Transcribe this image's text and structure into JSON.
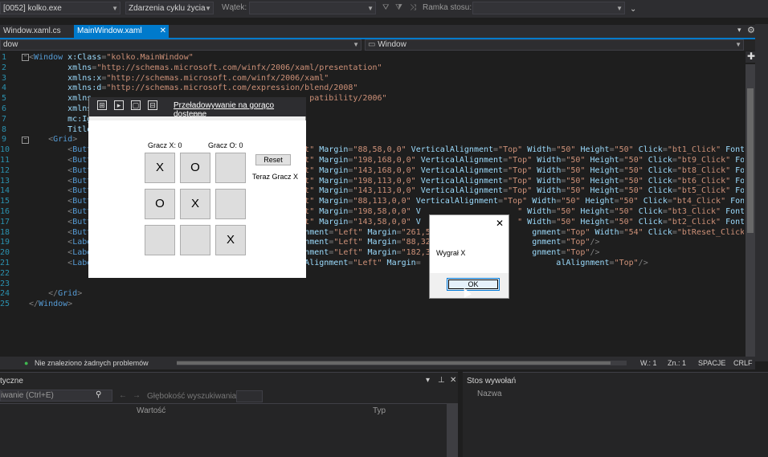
{
  "toolbar": {
    "process_value": "[0052] kolko.exe",
    "lifecycle_value": "Zdarzenia cyklu życia",
    "thread_label": "Wątek:",
    "thread_value": "",
    "stackframe_label": "Ramka stosu:",
    "stackframe_value": ""
  },
  "tabs": [
    {
      "label": "Window.xaml.cs"
    },
    {
      "label": "MainWindow.xaml",
      "close": "✕"
    }
  ],
  "nav": {
    "left": "dow",
    "right": "Window"
  },
  "editor": {
    "line_numbers": [
      "1",
      "2",
      "3",
      "4",
      "5",
      "6",
      "7",
      "8",
      "9",
      "10",
      "11",
      "12",
      "13",
      "14",
      "15",
      "16",
      "17",
      "18",
      "19",
      "20",
      "21",
      "22",
      "23",
      "24",
      "25"
    ],
    "lines": [
      [
        {
          "c": "p",
          "t": "<"
        },
        {
          "c": "t",
          "t": "Window"
        },
        {
          "c": "a",
          "t": " x:Class"
        },
        {
          "c": "p",
          "t": "="
        },
        {
          "c": "s",
          "t": "\"kolko.MainWindow\""
        }
      ],
      [
        {
          "c": "a",
          "t": "        xmlns"
        },
        {
          "c": "p",
          "t": "="
        },
        {
          "c": "s",
          "t": "\"http://schemas.microsoft.com/winfx/2006/xaml/presentation\""
        }
      ],
      [
        {
          "c": "a",
          "t": "        xmlns:x"
        },
        {
          "c": "p",
          "t": "="
        },
        {
          "c": "s",
          "t": "\"http://schemas.microsoft.com/winfx/2006/xaml\""
        }
      ],
      [
        {
          "c": "a",
          "t": "        xmlns:d"
        },
        {
          "c": "p",
          "t": "="
        },
        {
          "c": "s",
          "t": "\"http://schemas.microsoft.com/expression/blend/2008\""
        }
      ],
      [
        {
          "c": "a",
          "t": "        xmlns"
        },
        {
          "c": "s",
          "t": "                                             patibility/2006\""
        }
      ],
      [
        {
          "c": "a",
          "t": "        xmlns"
        }
      ],
      [
        {
          "c": "a",
          "t": "        mc:Ig"
        }
      ],
      [
        {
          "c": "a",
          "t": "        Title"
        },
        {
          "c": "s",
          "t": "                                         4\""
        },
        {
          "c": "p",
          "t": ">"
        }
      ],
      [
        {
          "c": "p",
          "t": "    <"
        },
        {
          "c": "t",
          "t": "Grid"
        },
        {
          "c": "p",
          "t": ">"
        }
      ],
      [
        {
          "c": "p",
          "t": "        <"
        },
        {
          "c": "t",
          "t": "Butt"
        },
        {
          "c": "s",
          "t": "                                          eft\""
        },
        {
          "c": "a",
          "t": " Margin"
        },
        {
          "c": "p",
          "t": "="
        },
        {
          "c": "s",
          "t": "\"88,58,0,0\""
        },
        {
          "c": "a",
          "t": " VerticalAlignment"
        },
        {
          "c": "p",
          "t": "="
        },
        {
          "c": "s",
          "t": "\"Top\""
        },
        {
          "c": "a",
          "t": " Width"
        },
        {
          "c": "p",
          "t": "="
        },
        {
          "c": "s",
          "t": "\"50\""
        },
        {
          "c": "a",
          "t": " Height"
        },
        {
          "c": "p",
          "t": "="
        },
        {
          "c": "s",
          "t": "\"50\""
        },
        {
          "c": "a",
          "t": " Click"
        },
        {
          "c": "p",
          "t": "="
        },
        {
          "c": "s",
          "t": "\"bt1_Click\""
        },
        {
          "c": "a",
          "t": " FontSize"
        }
      ],
      [
        {
          "c": "p",
          "t": "        <"
        },
        {
          "c": "t",
          "t": "Butt"
        },
        {
          "c": "s",
          "t": "                                          eft\""
        },
        {
          "c": "a",
          "t": " Margin"
        },
        {
          "c": "p",
          "t": "="
        },
        {
          "c": "s",
          "t": "\"198,168,0,0\""
        },
        {
          "c": "a",
          "t": " VerticalAlignment"
        },
        {
          "c": "p",
          "t": "="
        },
        {
          "c": "s",
          "t": "\"Top\""
        },
        {
          "c": "a",
          "t": " Width"
        },
        {
          "c": "p",
          "t": "="
        },
        {
          "c": "s",
          "t": "\"50\""
        },
        {
          "c": "a",
          "t": " Height"
        },
        {
          "c": "p",
          "t": "="
        },
        {
          "c": "s",
          "t": "\"50\""
        },
        {
          "c": "a",
          "t": " Click"
        },
        {
          "c": "p",
          "t": "="
        },
        {
          "c": "s",
          "t": "\"bt9_Click\""
        },
        {
          "c": "a",
          "t": " FontSi"
        }
      ],
      [
        {
          "c": "p",
          "t": "        <"
        },
        {
          "c": "t",
          "t": "Butt"
        },
        {
          "c": "s",
          "t": "                                          eft\""
        },
        {
          "c": "a",
          "t": " Margin"
        },
        {
          "c": "p",
          "t": "="
        },
        {
          "c": "s",
          "t": "\"143,168,0,0\""
        },
        {
          "c": "a",
          "t": " VerticalAlignment"
        },
        {
          "c": "p",
          "t": "="
        },
        {
          "c": "s",
          "t": "\"Top\""
        },
        {
          "c": "a",
          "t": " Width"
        },
        {
          "c": "p",
          "t": "="
        },
        {
          "c": "s",
          "t": "\"50\""
        },
        {
          "c": "a",
          "t": " Height"
        },
        {
          "c": "p",
          "t": "="
        },
        {
          "c": "s",
          "t": "\"50\""
        },
        {
          "c": "a",
          "t": " Click"
        },
        {
          "c": "p",
          "t": "="
        },
        {
          "c": "s",
          "t": "\"bt8_Click\""
        },
        {
          "c": "a",
          "t": " FontSi"
        }
      ],
      [
        {
          "c": "p",
          "t": "        <"
        },
        {
          "c": "t",
          "t": "Butt"
        },
        {
          "c": "s",
          "t": "                                          eft\""
        },
        {
          "c": "a",
          "t": " Margin"
        },
        {
          "c": "p",
          "t": "="
        },
        {
          "c": "s",
          "t": "\"198,113,0,0\""
        },
        {
          "c": "a",
          "t": " VerticalAlignment"
        },
        {
          "c": "p",
          "t": "="
        },
        {
          "c": "s",
          "t": "\"Top\""
        },
        {
          "c": "a",
          "t": " Width"
        },
        {
          "c": "p",
          "t": "="
        },
        {
          "c": "s",
          "t": "\"50\""
        },
        {
          "c": "a",
          "t": " Height"
        },
        {
          "c": "p",
          "t": "="
        },
        {
          "c": "s",
          "t": "\"50\""
        },
        {
          "c": "a",
          "t": " Click"
        },
        {
          "c": "p",
          "t": "="
        },
        {
          "c": "s",
          "t": "\"bt6_Click\""
        },
        {
          "c": "a",
          "t": " FontSi"
        }
      ],
      [
        {
          "c": "p",
          "t": "        <"
        },
        {
          "c": "t",
          "t": "Butt"
        },
        {
          "c": "s",
          "t": "                                          eft\""
        },
        {
          "c": "a",
          "t": " Margin"
        },
        {
          "c": "p",
          "t": "="
        },
        {
          "c": "s",
          "t": "\"143,113,0,0\""
        },
        {
          "c": "a",
          "t": " VerticalAlignment"
        },
        {
          "c": "p",
          "t": "="
        },
        {
          "c": "s",
          "t": "\"Top\""
        },
        {
          "c": "a",
          "t": " Width"
        },
        {
          "c": "p",
          "t": "="
        },
        {
          "c": "s",
          "t": "\"50\""
        },
        {
          "c": "a",
          "t": " Height"
        },
        {
          "c": "p",
          "t": "="
        },
        {
          "c": "s",
          "t": "\"50\""
        },
        {
          "c": "a",
          "t": " Click"
        },
        {
          "c": "p",
          "t": "="
        },
        {
          "c": "s",
          "t": "\"bt5_Click\""
        },
        {
          "c": "a",
          "t": " FontSi"
        }
      ],
      [
        {
          "c": "p",
          "t": "        <"
        },
        {
          "c": "t",
          "t": "Butt"
        },
        {
          "c": "s",
          "t": "                                          eft\""
        },
        {
          "c": "a",
          "t": " Margin"
        },
        {
          "c": "p",
          "t": "="
        },
        {
          "c": "s",
          "t": "\"88,113,0,0\""
        },
        {
          "c": "a",
          "t": " VerticalAlignment"
        },
        {
          "c": "p",
          "t": "="
        },
        {
          "c": "s",
          "t": "\"Top\""
        },
        {
          "c": "a",
          "t": " Width"
        },
        {
          "c": "p",
          "t": "="
        },
        {
          "c": "s",
          "t": "\"50\""
        },
        {
          "c": "a",
          "t": " Height"
        },
        {
          "c": "p",
          "t": "="
        },
        {
          "c": "s",
          "t": "\"50\""
        },
        {
          "c": "a",
          "t": " Click"
        },
        {
          "c": "p",
          "t": "="
        },
        {
          "c": "s",
          "t": "\"bt4_Click\""
        },
        {
          "c": "a",
          "t": " FontSi"
        }
      ],
      [
        {
          "c": "p",
          "t": "        <"
        },
        {
          "c": "t",
          "t": "Butt"
        },
        {
          "c": "s",
          "t": "                                          eft\""
        },
        {
          "c": "a",
          "t": " Margin"
        },
        {
          "c": "p",
          "t": "="
        },
        {
          "c": "s",
          "t": "\"198,58,0,0\""
        },
        {
          "c": "a",
          "t": " V"
        },
        {
          "c": "s",
          "t": "                    \""
        },
        {
          "c": "a",
          "t": " Width"
        },
        {
          "c": "p",
          "t": "="
        },
        {
          "c": "s",
          "t": "\"50\""
        },
        {
          "c": "a",
          "t": " Height"
        },
        {
          "c": "p",
          "t": "="
        },
        {
          "c": "s",
          "t": "\"50\""
        },
        {
          "c": "a",
          "t": " Click"
        },
        {
          "c": "p",
          "t": "="
        },
        {
          "c": "s",
          "t": "\"bt3_Click\""
        },
        {
          "c": "a",
          "t": " FontSi"
        }
      ],
      [
        {
          "c": "p",
          "t": "        <"
        },
        {
          "c": "t",
          "t": "Butt"
        },
        {
          "c": "s",
          "t": "                                          eft\""
        },
        {
          "c": "a",
          "t": " Margin"
        },
        {
          "c": "p",
          "t": "="
        },
        {
          "c": "s",
          "t": "\"143,58,0,0\""
        },
        {
          "c": "a",
          "t": " V"
        },
        {
          "c": "s",
          "t": "                    \""
        },
        {
          "c": "a",
          "t": " Width"
        },
        {
          "c": "p",
          "t": "="
        },
        {
          "c": "s",
          "t": "\"50\""
        },
        {
          "c": "a",
          "t": " Height"
        },
        {
          "c": "p",
          "t": "="
        },
        {
          "c": "s",
          "t": "\"50\""
        },
        {
          "c": "a",
          "t": " Click"
        },
        {
          "c": "p",
          "t": "="
        },
        {
          "c": "s",
          "t": "\"bt2_Click\""
        },
        {
          "c": "a",
          "t": " FontSi"
        }
      ],
      [
        {
          "c": "p",
          "t": "        <"
        },
        {
          "c": "t",
          "t": "Butt"
        },
        {
          "c": "a",
          "t": "                                          ignment"
        },
        {
          "c": "p",
          "t": "="
        },
        {
          "c": "s",
          "t": "\"Left\""
        },
        {
          "c": "a",
          "t": " Margin"
        },
        {
          "c": "p",
          "t": "="
        },
        {
          "c": "s",
          "t": "\"261,5"
        },
        {
          "c": "a",
          "t": "                     gnment"
        },
        {
          "c": "p",
          "t": "="
        },
        {
          "c": "s",
          "t": "\"Top\""
        },
        {
          "c": "a",
          "t": " Width"
        },
        {
          "c": "p",
          "t": "="
        },
        {
          "c": "s",
          "t": "\"54\""
        },
        {
          "c": "a",
          "t": " Click"
        },
        {
          "c": "p",
          "t": "="
        },
        {
          "c": "s",
          "t": "\"btReset_Click\""
        },
        {
          "c": "p",
          "t": "/>"
        }
      ],
      [
        {
          "c": "p",
          "t": "        <"
        },
        {
          "c": "t",
          "t": "Labe"
        },
        {
          "c": "a",
          "t": "                                          ignment"
        },
        {
          "c": "p",
          "t": "="
        },
        {
          "c": "s",
          "t": "\"Left\""
        },
        {
          "c": "a",
          "t": " Margin"
        },
        {
          "c": "p",
          "t": "="
        },
        {
          "c": "s",
          "t": "\"88,32"
        },
        {
          "c": "a",
          "t": "                     gnment"
        },
        {
          "c": "p",
          "t": "="
        },
        {
          "c": "s",
          "t": "\"Top\""
        },
        {
          "c": "p",
          "t": "/>"
        }
      ],
      [
        {
          "c": "p",
          "t": "        <"
        },
        {
          "c": "t",
          "t": "Labe"
        },
        {
          "c": "a",
          "t": "                                          ignment"
        },
        {
          "c": "p",
          "t": "="
        },
        {
          "c": "s",
          "t": "\"Left\""
        },
        {
          "c": "a",
          "t": " Margin"
        },
        {
          "c": "p",
          "t": "="
        },
        {
          "c": "s",
          "t": "\"182,3"
        },
        {
          "c": "a",
          "t": "                     gnment"
        },
        {
          "c": "p",
          "t": "="
        },
        {
          "c": "s",
          "t": "\"Top\""
        },
        {
          "c": "p",
          "t": "/>"
        }
      ],
      [
        {
          "c": "p",
          "t": "        <"
        },
        {
          "c": "t",
          "t": "Labe"
        },
        {
          "c": "a",
          "t": "                                          alAlignment"
        },
        {
          "c": "p",
          "t": "="
        },
        {
          "c": "s",
          "t": "\"Left\""
        },
        {
          "c": "a",
          "t": " Margin"
        },
        {
          "c": "p",
          "t": "="
        },
        {
          "c": "s",
          "t": "                            "
        },
        {
          "c": "a",
          "t": "alAlignment"
        },
        {
          "c": "p",
          "t": "="
        },
        {
          "c": "s",
          "t": "\"Top\""
        },
        {
          "c": "p",
          "t": "/>"
        }
      ],
      [],
      [],
      [
        {
          "c": "p",
          "t": "    </"
        },
        {
          "c": "t",
          "t": "Grid"
        },
        {
          "c": "p",
          "t": ">"
        }
      ],
      [
        {
          "c": "p",
          "t": "</"
        },
        {
          "c": "t",
          "t": "Window"
        },
        {
          "c": "p",
          "t": ">"
        }
      ]
    ]
  },
  "status": {
    "problems": "Nie znaleziono żadnych problemów",
    "line": "W.: 1",
    "col": "Zn.: 1",
    "spaces": "SPACJE",
    "eol": "CRLF"
  },
  "panel_left": {
    "title": "tyczne",
    "search_placeholder": "iwanie (Ctrl+E)",
    "depth_label": "Głębokość wyszukiwania:",
    "col_value": "Wartość",
    "col_type": "Typ"
  },
  "panel_right": {
    "title": "Stos wywołań",
    "col_name": "Nazwa"
  },
  "hot_reload": {
    "link": "Przeładowywanie na gorąco",
    "suffix": " dostępne"
  },
  "game": {
    "score_x": "Gracz X: 0",
    "score_o": "Gracz O: 0",
    "reset": "Reset",
    "turn": "Teraz Gracz X",
    "cells": [
      "X",
      "O",
      "",
      "O",
      "X",
      "",
      "",
      "",
      "X"
    ]
  },
  "msgbox": {
    "close": "✕",
    "text": "Wygrał X",
    "ok": "OK"
  },
  "colors": {
    "accent": "#007acc",
    "editor_bg": "#1e1e1e"
  }
}
